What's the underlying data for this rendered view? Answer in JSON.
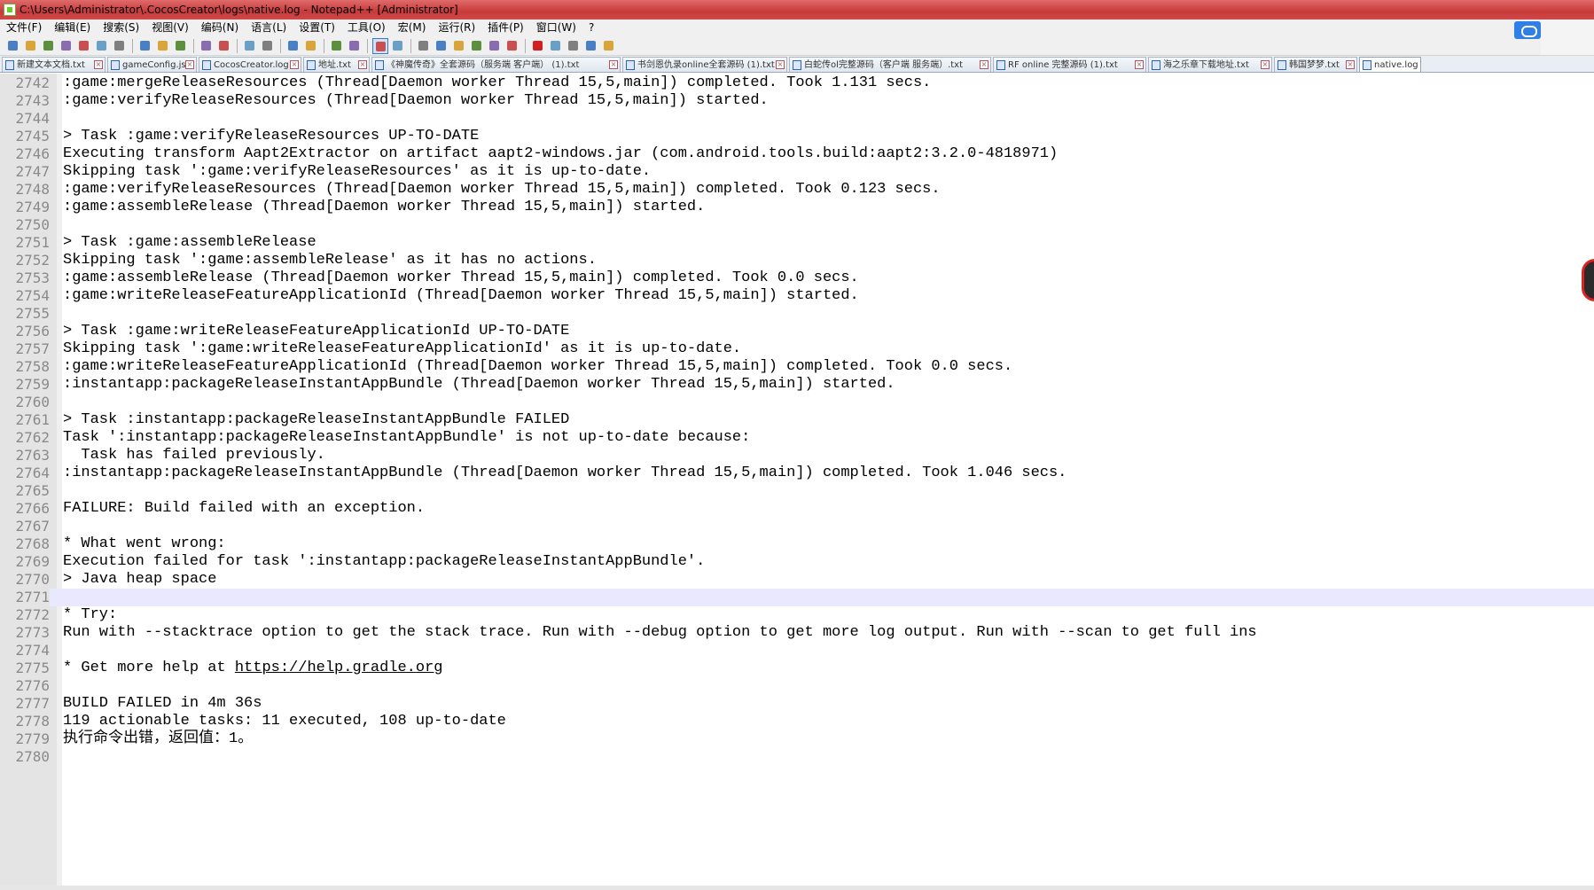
{
  "window": {
    "title": "C:\\Users\\Administrator\\.CocosCreator\\logs\\native.log - Notepad++ [Administrator]"
  },
  "menu": [
    "文件(F)",
    "编辑(E)",
    "搜索(S)",
    "视图(V)",
    "编码(N)",
    "语言(L)",
    "设置(T)",
    "工具(O)",
    "宏(M)",
    "运行(R)",
    "插件(P)",
    "窗口(W)",
    "?"
  ],
  "toolbar_icons": [
    "new-file-icon",
    "open-file-icon",
    "save-icon",
    "save-all-icon",
    "close-icon",
    "close-all-icon",
    "print-icon",
    "sep",
    "cut-icon",
    "copy-icon",
    "paste-icon",
    "sep",
    "undo-icon",
    "redo-icon",
    "sep",
    "find-icon",
    "replace-icon",
    "sep",
    "zoom-in-icon",
    "zoom-out-icon",
    "sep",
    "sync-vertical-icon",
    "sync-horizontal-icon",
    "sep",
    "word-wrap-icon",
    "show-all-chars-icon",
    "sep",
    "indent-guide-icon",
    "language-icon",
    "doc-map-icon",
    "function-list-icon",
    "folder-workspace-icon",
    "monitor-icon",
    "sep",
    "record-macro-icon",
    "stop-macro-icon",
    "play-macro-icon",
    "run-macro-multiple-icon",
    "save-macro-icon"
  ],
  "tabs": [
    {
      "label": "新建文本文档.txt"
    },
    {
      "label": "gameConfig.js"
    },
    {
      "label": "CocosCreator.log"
    },
    {
      "label": "地址.txt"
    },
    {
      "label": "《神魔传奇》全套源码（服务端 客户端） (1).txt"
    },
    {
      "label": "书剑恩仇录online全套源码 (1).txt"
    },
    {
      "label": "白蛇传ol完整源码（客户端 服务端）.txt"
    },
    {
      "label": "RF online 完整源码 (1).txt"
    },
    {
      "label": "海之乐章下载地址.txt"
    },
    {
      "label": "韩国梦梦.txt"
    },
    {
      "label": "native.log"
    }
  ],
  "editor": {
    "current_line": 2771,
    "lines": [
      {
        "n": "2742",
        "text": ":game:mergeReleaseResources (Thread[Daemon worker Thread 15,5,main]) completed. Took 1.131 secs."
      },
      {
        "n": "2743",
        "text": ":game:verifyReleaseResources (Thread[Daemon worker Thread 15,5,main]) started."
      },
      {
        "n": "2744",
        "text": ""
      },
      {
        "n": "2745",
        "text": "> Task :game:verifyReleaseResources UP-TO-DATE"
      },
      {
        "n": "2746",
        "text": "Executing transform Aapt2Extractor on artifact aapt2-windows.jar (com.android.tools.build:aapt2:3.2.0-4818971)"
      },
      {
        "n": "2747",
        "text": "Skipping task ':game:verifyReleaseResources' as it is up-to-date."
      },
      {
        "n": "2748",
        "text": ":game:verifyReleaseResources (Thread[Daemon worker Thread 15,5,main]) completed. Took 0.123 secs."
      },
      {
        "n": "2749",
        "text": ":game:assembleRelease (Thread[Daemon worker Thread 15,5,main]) started."
      },
      {
        "n": "2750",
        "text": ""
      },
      {
        "n": "2751",
        "text": "> Task :game:assembleRelease"
      },
      {
        "n": "2752",
        "text": "Skipping task ':game:assembleRelease' as it has no actions."
      },
      {
        "n": "2753",
        "text": ":game:assembleRelease (Thread[Daemon worker Thread 15,5,main]) completed. Took 0.0 secs."
      },
      {
        "n": "2754",
        "text": ":game:writeReleaseFeatureApplicationId (Thread[Daemon worker Thread 15,5,main]) started."
      },
      {
        "n": "2755",
        "text": ""
      },
      {
        "n": "2756",
        "text": "> Task :game:writeReleaseFeatureApplicationId UP-TO-DATE"
      },
      {
        "n": "2757",
        "text": "Skipping task ':game:writeReleaseFeatureApplicationId' as it is up-to-date."
      },
      {
        "n": "2758",
        "text": ":game:writeReleaseFeatureApplicationId (Thread[Daemon worker Thread 15,5,main]) completed. Took 0.0 secs."
      },
      {
        "n": "2759",
        "text": ":instantapp:packageReleaseInstantAppBundle (Thread[Daemon worker Thread 15,5,main]) started."
      },
      {
        "n": "2760",
        "text": ""
      },
      {
        "n": "2761",
        "text": "> Task :instantapp:packageReleaseInstantAppBundle FAILED"
      },
      {
        "n": "2762",
        "text": "Task ':instantapp:packageReleaseInstantAppBundle' is not up-to-date because:"
      },
      {
        "n": "2763",
        "text": "  Task has failed previously."
      },
      {
        "n": "2764",
        "text": ":instantapp:packageReleaseInstantAppBundle (Thread[Daemon worker Thread 15,5,main]) completed. Took 1.046 secs."
      },
      {
        "n": "2765",
        "text": ""
      },
      {
        "n": "2766",
        "text": "FAILURE: Build failed with an exception."
      },
      {
        "n": "2767",
        "text": ""
      },
      {
        "n": "2768",
        "text": "* What went wrong:"
      },
      {
        "n": "2769",
        "text": "Execution failed for task ':instantapp:packageReleaseInstantAppBundle'."
      },
      {
        "n": "2770",
        "text": "> Java heap space"
      },
      {
        "n": "2771",
        "text": ""
      },
      {
        "n": "2772",
        "text": "* Try:"
      },
      {
        "n": "2773",
        "text": "Run with --stacktrace option to get the stack trace. Run with --debug option to get more log output. Run with --scan to get full ins"
      },
      {
        "n": "2774",
        "text": ""
      },
      {
        "n": "2775",
        "text": "* Get more help at ",
        "link": "https://help.gradle.org"
      },
      {
        "n": "2776",
        "text": ""
      },
      {
        "n": "2777",
        "text": "BUILD FAILED in 4m 36s"
      },
      {
        "n": "2778",
        "text": "119 actionable tasks: 11 executed, 108 up-to-date"
      },
      {
        "n": "2779",
        "text": "执行命令出错，返回值：1。"
      },
      {
        "n": "2780",
        "text": ""
      }
    ]
  }
}
